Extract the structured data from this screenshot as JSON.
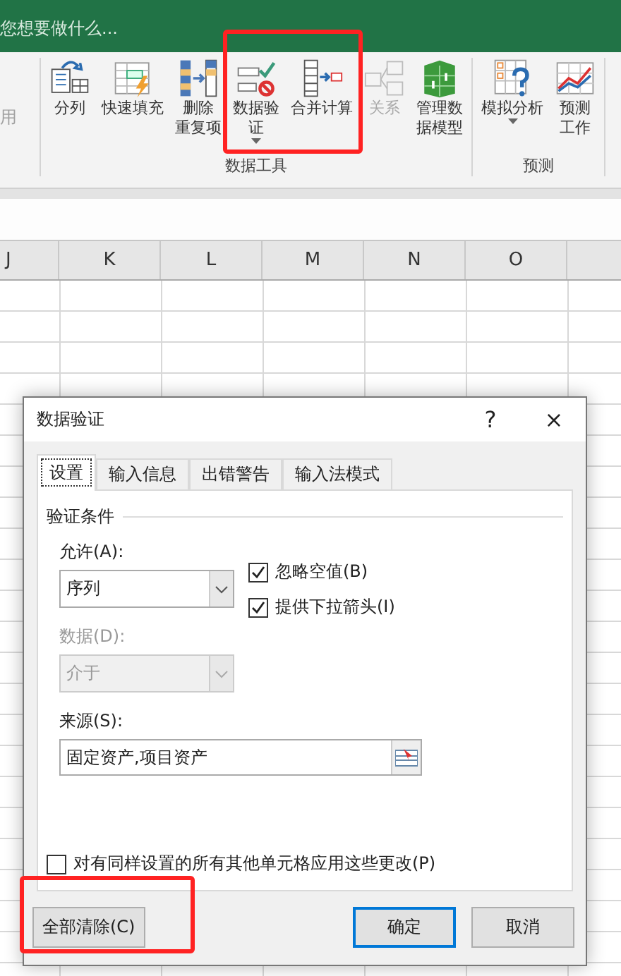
{
  "title_bar": {
    "tell_me": "您想要做什么..."
  },
  "ribbon": {
    "cut_label": "用",
    "groups": [
      {
        "label": "数据工具",
        "buttons": [
          {
            "kind": "split",
            "lines": [
              "分列"
            ],
            "dropdown": false,
            "disabled": false,
            "highlighted": false
          },
          {
            "kind": "flashfill",
            "lines": [
              "快速填充"
            ],
            "dropdown": false,
            "disabled": false,
            "highlighted": false
          },
          {
            "kind": "dedupe",
            "lines": [
              "删除",
              "重复项"
            ],
            "dropdown": false,
            "disabled": false,
            "highlighted": false
          },
          {
            "kind": "validate",
            "lines": [
              "数据验",
              "证"
            ],
            "dropdown": true,
            "disabled": false,
            "highlighted": true
          },
          {
            "kind": "consolidate",
            "lines": [
              "合并计算"
            ],
            "dropdown": false,
            "disabled": false,
            "highlighted": true
          },
          {
            "kind": "relations",
            "lines": [
              "关系"
            ],
            "dropdown": false,
            "disabled": true,
            "highlighted": false
          },
          {
            "kind": "model",
            "lines": [
              "管理数",
              "据模型"
            ],
            "dropdown": false,
            "disabled": false,
            "highlighted": false
          }
        ]
      },
      {
        "label": "预测",
        "buttons": [
          {
            "kind": "whatif",
            "lines": [
              "模拟分析"
            ],
            "dropdown": true,
            "disabled": false,
            "highlighted": false
          },
          {
            "kind": "forecast",
            "lines": [
              "预测",
              "工作"
            ],
            "dropdown": false,
            "disabled": false,
            "highlighted": false
          }
        ]
      }
    ]
  },
  "columns": [
    "J",
    "K",
    "L",
    "M",
    "N",
    "O"
  ],
  "dialog": {
    "title": "数据验证",
    "help": "?",
    "close": "×",
    "tabs": [
      {
        "label": "设置",
        "selected": true
      },
      {
        "label": "输入信息",
        "selected": false
      },
      {
        "label": "出错警告",
        "selected": false
      },
      {
        "label": "输入法模式",
        "selected": false
      }
    ],
    "section": "验证条件",
    "allow": {
      "label": "允许(A):",
      "value": "序列",
      "disabled": false
    },
    "data": {
      "label": "数据(D):",
      "value": "介于",
      "disabled": true
    },
    "options": [
      {
        "label": "忽略空值(B)",
        "checked": true
      },
      {
        "label": "提供下拉箭头(I)",
        "checked": true
      }
    ],
    "source": {
      "label": "来源(S):",
      "value": "固定资产,项目资产"
    },
    "apply_all": {
      "label": "对有同样设置的所有其他单元格应用这些更改(P)",
      "checked": false
    },
    "buttons": [
      {
        "kind": "left",
        "label": "全部清除(C)",
        "default": false,
        "highlighted": true
      },
      {
        "kind": "right",
        "label": "确定",
        "default": true,
        "highlighted": false
      },
      {
        "kind": "right",
        "label": "取消",
        "default": false,
        "highlighted": false
      }
    ]
  }
}
